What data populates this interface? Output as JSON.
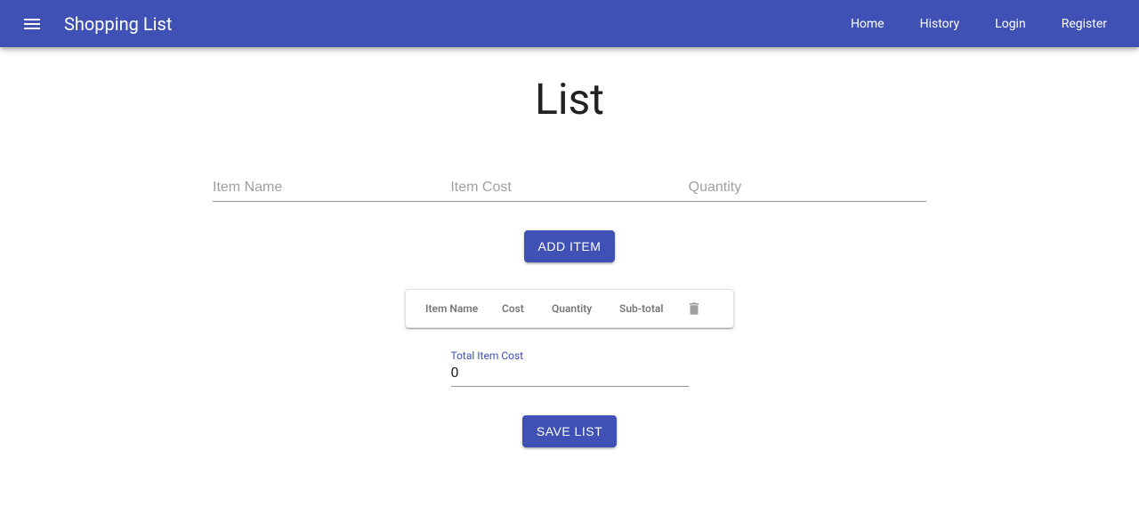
{
  "header": {
    "brand": "Shopping List",
    "nav": {
      "home": "Home",
      "history": "History",
      "login": "Login",
      "register": "Register"
    }
  },
  "page": {
    "title": "List"
  },
  "inputs": {
    "item_name_placeholder": "Item Name",
    "item_cost_placeholder": "Item Cost",
    "quantity_placeholder": "Quantity"
  },
  "buttons": {
    "add_item": "Add Item",
    "save_list": "Save List"
  },
  "table": {
    "headers": {
      "item_name": "Item Name",
      "cost": "Cost",
      "quantity": "Quantity",
      "sub_total": "Sub-total"
    }
  },
  "total": {
    "label": "Total Item Cost",
    "value": "0"
  }
}
